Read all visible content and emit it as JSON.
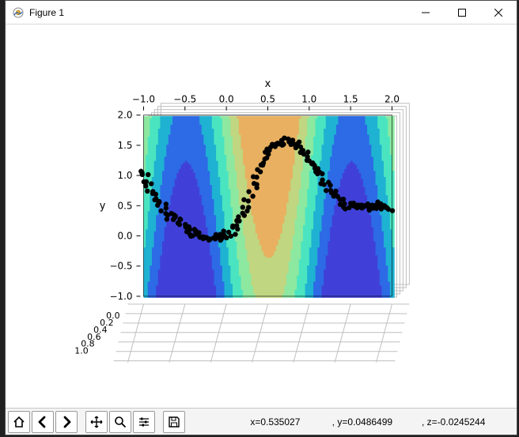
{
  "window": {
    "title": "Figure 1"
  },
  "toolbar": {
    "home": "Home",
    "back": "Back",
    "forward": "Forward",
    "pan": "Pan",
    "zoom": "Zoom",
    "configure": "Configure subplots",
    "save": "Save"
  },
  "status": {
    "x_label": "x=",
    "x_val": "0.535027",
    "y_label": ", y=",
    "y_val": "0.0486499",
    "z_label": ", z=",
    "z_val": "-0.0245244"
  },
  "chart_data": {
    "type": "heatmap",
    "title": "",
    "xlabel": "x",
    "ylabel": "y",
    "zlabel": "",
    "x_ticks": [
      -1.0,
      -0.5,
      0.0,
      0.5,
      1.0,
      1.5,
      2.0
    ],
    "y_ticks": [
      -1.0,
      -0.5,
      0.0,
      0.5,
      1.0,
      1.5,
      2.0
    ],
    "z_ticks": [
      0.0,
      0.2,
      0.4,
      0.6,
      0.8,
      1.0
    ],
    "xlim": [
      -1.0,
      2.0
    ],
    "ylim": [
      -1.0,
      2.0
    ],
    "zlim": [
      0.0,
      1.0
    ],
    "contour_levels": [
      0.0,
      0.14,
      0.28,
      0.42,
      0.57,
      0.71,
      0.85,
      1.0
    ],
    "contour_colors": [
      "#4040d8",
      "#2d6ae6",
      "#1fb2d2",
      "#4ae5c0",
      "#8de8a0",
      "#c0d680",
      "#e8b060",
      "#f05030"
    ],
    "scatter": {
      "note": "scatter of (x, y=sin(x*pi)+noise) samples, z≈0",
      "x": [
        -1.0,
        -0.97,
        -0.94,
        -0.91,
        -0.88,
        -0.85,
        -0.82,
        -0.79,
        -0.76,
        -0.73,
        -0.7,
        -0.67,
        -0.64,
        -0.61,
        -0.58,
        -0.55,
        -0.52,
        -0.49,
        -0.46,
        -0.43,
        -0.4,
        -0.37,
        -0.34,
        -0.31,
        -0.28,
        -0.25,
        -0.22,
        -0.19,
        -0.16,
        -0.13,
        -0.1,
        -0.07,
        -0.04,
        -0.01,
        0.02,
        0.05,
        0.08,
        0.11,
        0.14,
        0.17,
        0.2,
        0.23,
        0.26,
        0.29,
        0.32,
        0.35,
        0.38,
        0.41,
        0.44,
        0.47,
        0.5,
        0.53,
        0.56,
        0.59,
        0.62,
        0.65,
        0.68,
        0.71,
        0.74,
        0.77,
        0.8,
        0.83,
        0.86,
        0.89,
        0.92,
        0.95,
        0.98,
        1.01,
        1.04,
        1.07,
        1.1,
        1.13,
        1.16,
        1.19,
        1.22,
        1.25,
        1.28,
        1.31,
        1.34,
        1.37,
        1.4,
        1.43,
        1.46,
        1.49,
        1.52,
        1.55,
        1.58,
        1.61,
        1.64,
        1.67,
        1.7,
        1.73,
        1.76,
        1.79,
        1.82,
        1.85,
        1.88,
        1.91,
        1.94,
        1.97,
        2.0
      ],
      "y": [
        1.1,
        1.05,
        0.95,
        0.9,
        0.8,
        0.75,
        0.65,
        0.6,
        0.55,
        0.5,
        0.45,
        0.4,
        0.35,
        0.3,
        0.28,
        0.25,
        0.2,
        0.18,
        0.15,
        0.12,
        0.1,
        0.08,
        0.07,
        0.05,
        0.04,
        0.03,
        0.02,
        0.02,
        0.01,
        0.01,
        0.01,
        0.01,
        0.02,
        0.02,
        0.03,
        0.05,
        0.08,
        0.12,
        0.17,
        0.24,
        0.31,
        0.4,
        0.5,
        0.6,
        0.72,
        0.84,
        0.95,
        1.05,
        1.15,
        1.25,
        1.35,
        1.42,
        1.48,
        1.53,
        1.56,
        1.58,
        1.59,
        1.6,
        1.6,
        1.59,
        1.58,
        1.56,
        1.53,
        1.5,
        1.46,
        1.42,
        1.38,
        1.33,
        1.28,
        1.23,
        1.18,
        1.12,
        1.07,
        1.01,
        0.95,
        0.9,
        0.84,
        0.79,
        0.74,
        0.69,
        0.65,
        0.61,
        0.58,
        0.55,
        0.53,
        0.51,
        0.5,
        0.49,
        0.49,
        0.49,
        0.49,
        0.5,
        0.5,
        0.51,
        0.51,
        0.52,
        0.52,
        0.53,
        0.53,
        0.53,
        0.5
      ],
      "jitter": 0.06
    }
  }
}
